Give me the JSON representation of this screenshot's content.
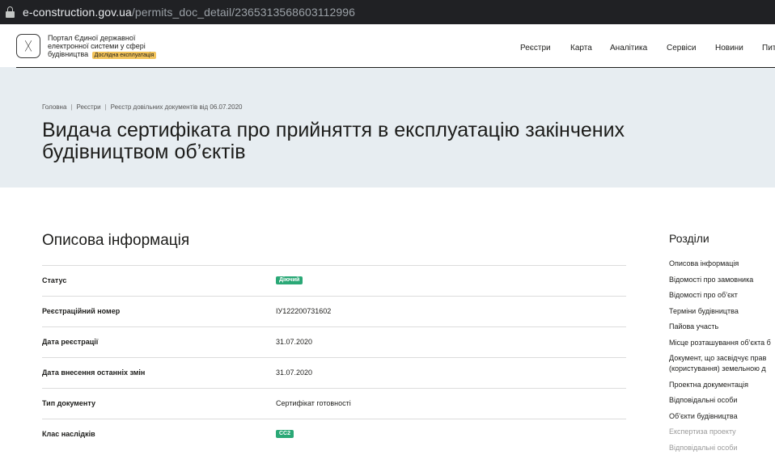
{
  "browser": {
    "url_host": "e-construction.gov.ua",
    "url_path": "/permits_doc_detail/2365313568603112996"
  },
  "header": {
    "portal_name": "Портал Єдиної державної електронної системи у сфері будівництва",
    "badge": "Дослідна експлуатація",
    "logo_icon": "trident-icon",
    "nav": [
      "Реєстри",
      "Карта",
      "Аналітика",
      "Сервіси",
      "Новини",
      "Пит"
    ]
  },
  "breadcrumb": [
    "Головна",
    "Реєстри",
    "Реєстр довільних документів від 06.07.2020"
  ],
  "page_title": {
    "line1": "Видача сертифіката про прийняття в експлуатацію закінчених",
    "line2": "будівництвом об’єктів"
  },
  "section": {
    "title": "Описова інформація",
    "rows": [
      {
        "key": "Статус",
        "value": "Діючий",
        "type": "badge"
      },
      {
        "key": "Реєстраційний номер",
        "value": "ІУ122200731602",
        "type": "text"
      },
      {
        "key": "Дата реєстрації",
        "value": "31.07.2020",
        "type": "text"
      },
      {
        "key": "Дата внесення останніх змін",
        "value": "31.07.2020",
        "type": "text"
      },
      {
        "key": "Тип документу",
        "value": "Сертифікат готовності",
        "type": "text"
      },
      {
        "key": "Клас наслідків",
        "value": "СС2",
        "type": "badge"
      }
    ]
  },
  "sidebar": {
    "title": "Розділи",
    "items": [
      {
        "label": "Описова інформація"
      },
      {
        "label": "Відомості про замовника"
      },
      {
        "label": "Відомості про об’єкт"
      },
      {
        "label": "Терміни будівництва"
      },
      {
        "label": "Пайова участь"
      },
      {
        "label": "Місце розташування об’єкта б"
      },
      {
        "label": "Документ, що засвідчує прав"
      },
      {
        "label": "(користування) земельною д"
      },
      {
        "label": "Проектна документація"
      },
      {
        "label": "Відповідальні особи"
      },
      {
        "label": "Об’єкти будівництва"
      },
      {
        "label": "Експертиза проекту"
      },
      {
        "label": "Відповідальні особи"
      }
    ]
  },
  "colors": {
    "accent_green": "#2aa876",
    "badge_yellow": "#f2c35a",
    "hero_bg": "#e7edf1"
  }
}
